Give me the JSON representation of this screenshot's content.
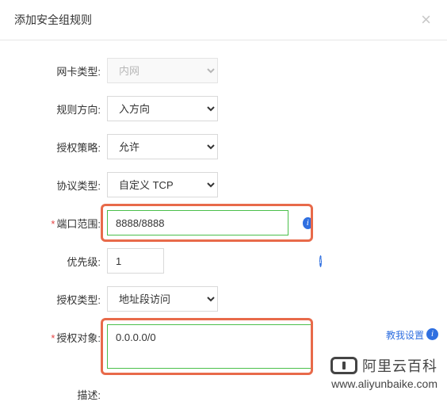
{
  "dialog": {
    "title": "添加安全组规则"
  },
  "form": {
    "nicType": {
      "label": "网卡类型:",
      "value": "内网"
    },
    "direction": {
      "label": "规则方向:",
      "value": "入方向"
    },
    "policy": {
      "label": "授权策略:",
      "value": "允许"
    },
    "protocol": {
      "label": "协议类型:",
      "value": "自定义 TCP"
    },
    "portRange": {
      "label": "端口范围:",
      "value": "8888/8888",
      "required": true
    },
    "priority": {
      "label": "优先级:",
      "value": "1"
    },
    "authType": {
      "label": "授权类型:",
      "value": "地址段访问"
    },
    "authObject": {
      "label": "授权对象:",
      "value": "0.0.0.0/0",
      "required": true,
      "helpText": "教我设置"
    },
    "description": {
      "label": "描述:",
      "value": ""
    }
  },
  "icons": {
    "info": "i"
  },
  "watermark": {
    "brand": "阿里云百科",
    "url": "www.aliyunbaike.com"
  }
}
